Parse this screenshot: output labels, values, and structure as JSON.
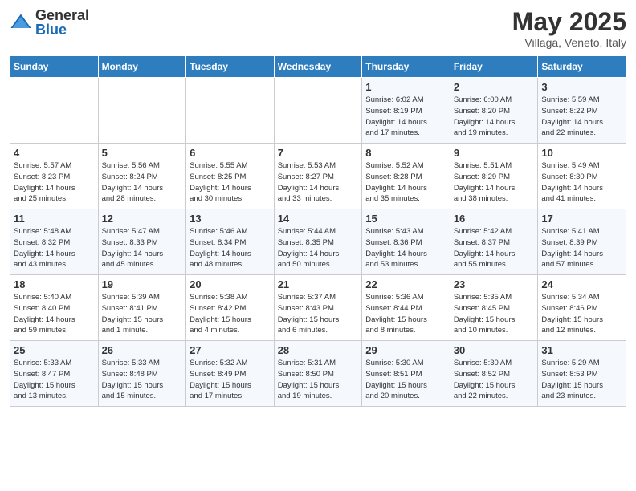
{
  "header": {
    "logo_general": "General",
    "logo_blue": "Blue",
    "main_title": "May 2025",
    "subtitle": "Villaga, Veneto, Italy"
  },
  "days_of_week": [
    "Sunday",
    "Monday",
    "Tuesday",
    "Wednesday",
    "Thursday",
    "Friday",
    "Saturday"
  ],
  "weeks": [
    [
      {
        "day": "",
        "detail": ""
      },
      {
        "day": "",
        "detail": ""
      },
      {
        "day": "",
        "detail": ""
      },
      {
        "day": "",
        "detail": ""
      },
      {
        "day": "1",
        "detail": "Sunrise: 6:02 AM\nSunset: 8:19 PM\nDaylight: 14 hours\nand 17 minutes."
      },
      {
        "day": "2",
        "detail": "Sunrise: 6:00 AM\nSunset: 8:20 PM\nDaylight: 14 hours\nand 19 minutes."
      },
      {
        "day": "3",
        "detail": "Sunrise: 5:59 AM\nSunset: 8:22 PM\nDaylight: 14 hours\nand 22 minutes."
      }
    ],
    [
      {
        "day": "4",
        "detail": "Sunrise: 5:57 AM\nSunset: 8:23 PM\nDaylight: 14 hours\nand 25 minutes."
      },
      {
        "day": "5",
        "detail": "Sunrise: 5:56 AM\nSunset: 8:24 PM\nDaylight: 14 hours\nand 28 minutes."
      },
      {
        "day": "6",
        "detail": "Sunrise: 5:55 AM\nSunset: 8:25 PM\nDaylight: 14 hours\nand 30 minutes."
      },
      {
        "day": "7",
        "detail": "Sunrise: 5:53 AM\nSunset: 8:27 PM\nDaylight: 14 hours\nand 33 minutes."
      },
      {
        "day": "8",
        "detail": "Sunrise: 5:52 AM\nSunset: 8:28 PM\nDaylight: 14 hours\nand 35 minutes."
      },
      {
        "day": "9",
        "detail": "Sunrise: 5:51 AM\nSunset: 8:29 PM\nDaylight: 14 hours\nand 38 minutes."
      },
      {
        "day": "10",
        "detail": "Sunrise: 5:49 AM\nSunset: 8:30 PM\nDaylight: 14 hours\nand 41 minutes."
      }
    ],
    [
      {
        "day": "11",
        "detail": "Sunrise: 5:48 AM\nSunset: 8:32 PM\nDaylight: 14 hours\nand 43 minutes."
      },
      {
        "day": "12",
        "detail": "Sunrise: 5:47 AM\nSunset: 8:33 PM\nDaylight: 14 hours\nand 45 minutes."
      },
      {
        "day": "13",
        "detail": "Sunrise: 5:46 AM\nSunset: 8:34 PM\nDaylight: 14 hours\nand 48 minutes."
      },
      {
        "day": "14",
        "detail": "Sunrise: 5:44 AM\nSunset: 8:35 PM\nDaylight: 14 hours\nand 50 minutes."
      },
      {
        "day": "15",
        "detail": "Sunrise: 5:43 AM\nSunset: 8:36 PM\nDaylight: 14 hours\nand 53 minutes."
      },
      {
        "day": "16",
        "detail": "Sunrise: 5:42 AM\nSunset: 8:37 PM\nDaylight: 14 hours\nand 55 minutes."
      },
      {
        "day": "17",
        "detail": "Sunrise: 5:41 AM\nSunset: 8:39 PM\nDaylight: 14 hours\nand 57 minutes."
      }
    ],
    [
      {
        "day": "18",
        "detail": "Sunrise: 5:40 AM\nSunset: 8:40 PM\nDaylight: 14 hours\nand 59 minutes."
      },
      {
        "day": "19",
        "detail": "Sunrise: 5:39 AM\nSunset: 8:41 PM\nDaylight: 15 hours\nand 1 minute."
      },
      {
        "day": "20",
        "detail": "Sunrise: 5:38 AM\nSunset: 8:42 PM\nDaylight: 15 hours\nand 4 minutes."
      },
      {
        "day": "21",
        "detail": "Sunrise: 5:37 AM\nSunset: 8:43 PM\nDaylight: 15 hours\nand 6 minutes."
      },
      {
        "day": "22",
        "detail": "Sunrise: 5:36 AM\nSunset: 8:44 PM\nDaylight: 15 hours\nand 8 minutes."
      },
      {
        "day": "23",
        "detail": "Sunrise: 5:35 AM\nSunset: 8:45 PM\nDaylight: 15 hours\nand 10 minutes."
      },
      {
        "day": "24",
        "detail": "Sunrise: 5:34 AM\nSunset: 8:46 PM\nDaylight: 15 hours\nand 12 minutes."
      }
    ],
    [
      {
        "day": "25",
        "detail": "Sunrise: 5:33 AM\nSunset: 8:47 PM\nDaylight: 15 hours\nand 13 minutes."
      },
      {
        "day": "26",
        "detail": "Sunrise: 5:33 AM\nSunset: 8:48 PM\nDaylight: 15 hours\nand 15 minutes."
      },
      {
        "day": "27",
        "detail": "Sunrise: 5:32 AM\nSunset: 8:49 PM\nDaylight: 15 hours\nand 17 minutes."
      },
      {
        "day": "28",
        "detail": "Sunrise: 5:31 AM\nSunset: 8:50 PM\nDaylight: 15 hours\nand 19 minutes."
      },
      {
        "day": "29",
        "detail": "Sunrise: 5:30 AM\nSunset: 8:51 PM\nDaylight: 15 hours\nand 20 minutes."
      },
      {
        "day": "30",
        "detail": "Sunrise: 5:30 AM\nSunset: 8:52 PM\nDaylight: 15 hours\nand 22 minutes."
      },
      {
        "day": "31",
        "detail": "Sunrise: 5:29 AM\nSunset: 8:53 PM\nDaylight: 15 hours\nand 23 minutes."
      }
    ]
  ]
}
